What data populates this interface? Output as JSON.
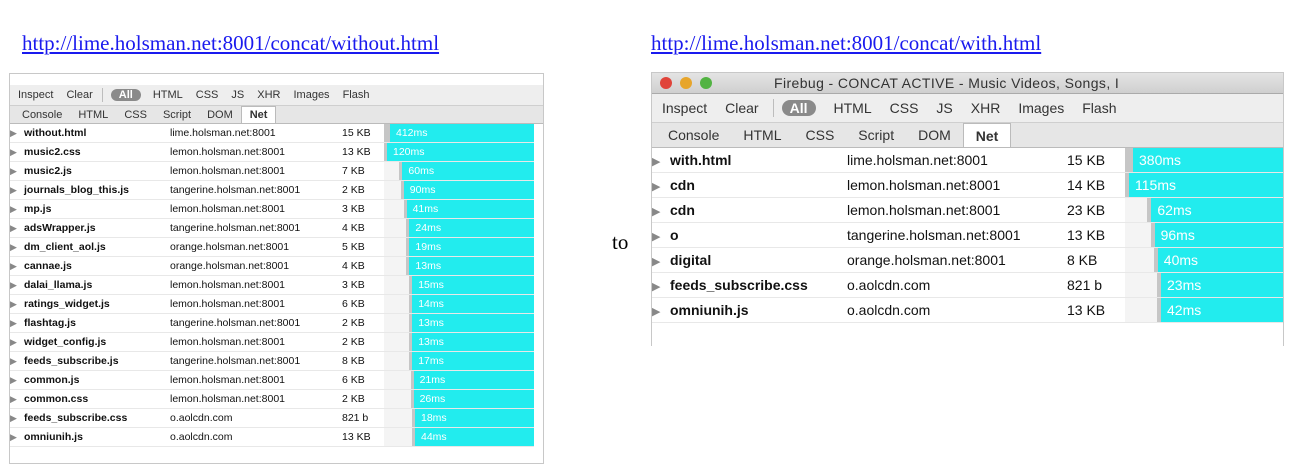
{
  "left_link": "http://lime.holsman.net:8001/concat/without.html",
  "right_link": "http://lime.holsman.net:8001/concat/with.html",
  "connector": "to",
  "toolbar": {
    "inspect": "Inspect",
    "clear": "Clear",
    "all": "All",
    "html": "HTML",
    "css": "CSS",
    "js": "JS",
    "xhr": "XHR",
    "images": "Images",
    "flash": "Flash"
  },
  "tabs": {
    "console": "Console",
    "html": "HTML",
    "css": "CSS",
    "script": "Script",
    "dom": "DOM",
    "net": "Net"
  },
  "right_window_title": "Firebug - CONCAT ACTIVE - Music Videos, Songs, I",
  "colors": {
    "bar": "#22ecee",
    "wait": "#c6c6c6",
    "link": "#1a1aee"
  },
  "left_requests": [
    {
      "file": "without.html",
      "domain": "lime.holsman.net:8001",
      "size": "15 KB",
      "time": "412ms",
      "ms": 412,
      "start": 0
    },
    {
      "file": "music2.css",
      "domain": "lemon.holsman.net:8001",
      "size": "13 KB",
      "time": "120ms",
      "ms": 120,
      "start": 0
    },
    {
      "file": "music2.js",
      "domain": "lemon.holsman.net:8001",
      "size": "7 KB",
      "time": "60ms",
      "ms": 60,
      "start": 11
    },
    {
      "file": "journals_blog_this.js",
      "domain": "tangerine.holsman.net:8001",
      "size": "2 KB",
      "time": "90ms",
      "ms": 90,
      "start": 12
    },
    {
      "file": "mp.js",
      "domain": "lemon.holsman.net:8001",
      "size": "3 KB",
      "time": "41ms",
      "ms": 41,
      "start": 14
    },
    {
      "file": "adsWrapper.js",
      "domain": "tangerine.holsman.net:8001",
      "size": "4 KB",
      "time": "24ms",
      "ms": 24,
      "start": 16
    },
    {
      "file": "dm_client_aol.js",
      "domain": "orange.holsman.net:8001",
      "size": "5 KB",
      "time": "19ms",
      "ms": 19,
      "start": 16
    },
    {
      "file": "cannae.js",
      "domain": "orange.holsman.net:8001",
      "size": "4 KB",
      "time": "13ms",
      "ms": 13,
      "start": 16
    },
    {
      "file": "dalai_llama.js",
      "domain": "lemon.holsman.net:8001",
      "size": "3 KB",
      "time": "15ms",
      "ms": 15,
      "start": 18
    },
    {
      "file": "ratings_widget.js",
      "domain": "lemon.holsman.net:8001",
      "size": "6 KB",
      "time": "14ms",
      "ms": 14,
      "start": 18
    },
    {
      "file": "flashtag.js",
      "domain": "tangerine.holsman.net:8001",
      "size": "2 KB",
      "time": "13ms",
      "ms": 13,
      "start": 18
    },
    {
      "file": "widget_config.js",
      "domain": "lemon.holsman.net:8001",
      "size": "2 KB",
      "time": "13ms",
      "ms": 13,
      "start": 18
    },
    {
      "file": "feeds_subscribe.js",
      "domain": "tangerine.holsman.net:8001",
      "size": "8 KB",
      "time": "17ms",
      "ms": 17,
      "start": 18
    },
    {
      "file": "common.js",
      "domain": "lemon.holsman.net:8001",
      "size": "6 KB",
      "time": "21ms",
      "ms": 21,
      "start": 19
    },
    {
      "file": "common.css",
      "domain": "lemon.holsman.net:8001",
      "size": "2 KB",
      "time": "26ms",
      "ms": 26,
      "start": 19
    },
    {
      "file": "feeds_subscribe.css",
      "domain": "o.aolcdn.com",
      "size": "821 b",
      "time": "18ms",
      "ms": 18,
      "start": 20
    },
    {
      "file": "omniunih.js",
      "domain": "o.aolcdn.com",
      "size": "13 KB",
      "time": "44ms",
      "ms": 44,
      "start": 20
    }
  ],
  "right_requests": [
    {
      "file": "with.html",
      "domain": "lime.holsman.net:8001",
      "size": "15 KB",
      "time": "380ms",
      "ms": 380,
      "start": 0
    },
    {
      "file": "cdn",
      "domain": "lemon.holsman.net:8001",
      "size": "14 KB",
      "time": "115ms",
      "ms": 115,
      "start": 0
    },
    {
      "file": "cdn",
      "domain": "lemon.holsman.net:8001",
      "size": "23 KB",
      "time": "62ms",
      "ms": 62,
      "start": 7
    },
    {
      "file": "o",
      "domain": "tangerine.holsman.net:8001",
      "size": "13 KB",
      "time": "96ms",
      "ms": 96,
      "start": 8
    },
    {
      "file": "digital",
      "domain": "orange.holsman.net:8001",
      "size": "8 KB",
      "time": "40ms",
      "ms": 40,
      "start": 9
    },
    {
      "file": "feeds_subscribe.css",
      "domain": "o.aolcdn.com",
      "size": "821 b",
      "time": "23ms",
      "ms": 23,
      "start": 10
    },
    {
      "file": "omniunih.js",
      "domain": "o.aolcdn.com",
      "size": "13 KB",
      "time": "42ms",
      "ms": 42,
      "start": 10
    }
  ]
}
